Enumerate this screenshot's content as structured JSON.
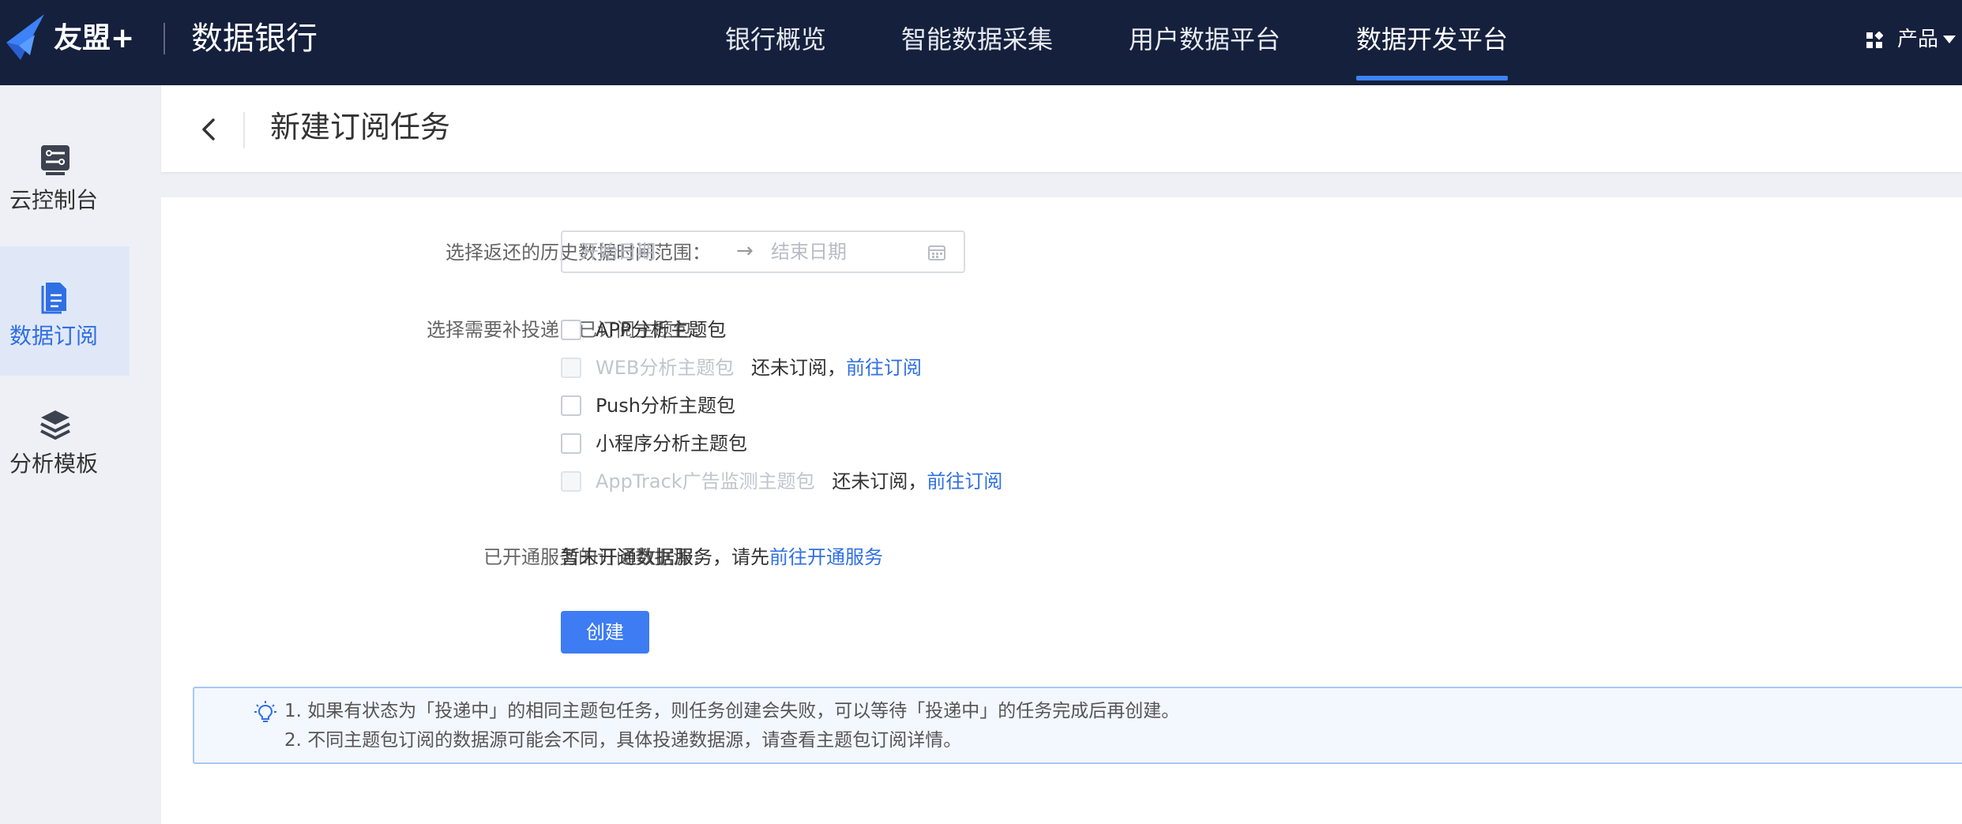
{
  "topbar": {
    "brand": "友盟+",
    "app_name": "数据银行",
    "nav": [
      {
        "label": "银行概览"
      },
      {
        "label": "智能数据采集"
      },
      {
        "label": "用户数据平台"
      },
      {
        "label": "数据开发平台",
        "active": true
      }
    ],
    "product_label": "产品"
  },
  "sidebar": {
    "items": [
      {
        "label": "云控制台",
        "icon": "server-icon"
      },
      {
        "label": "数据订阅",
        "icon": "document-icon",
        "active": true
      },
      {
        "label": "分析模板",
        "icon": "layers-icon"
      }
    ]
  },
  "header": {
    "title": "新建订阅任务"
  },
  "form": {
    "date_label": "选择返还的历史数据时间范围：",
    "date_start_placeholder": "开始日期",
    "date_arrow": "→",
    "date_end_placeholder": "结束日期",
    "package_label": "选择需要补投递的已订阅主题包：",
    "packages": [
      {
        "label": "APP分析主题包",
        "disabled": false
      },
      {
        "label": "WEB分析主题包",
        "disabled": true,
        "note": "还未订阅，",
        "link": "前往订阅"
      },
      {
        "label": "Push分析主题包",
        "disabled": false
      },
      {
        "label": "小程序分析主题包",
        "disabled": false
      },
      {
        "label": "AppTrack广告监测主题包",
        "disabled": true,
        "note": "还未订阅，",
        "link": "前往订阅"
      }
    ],
    "source_label": "已开通服务的订阅数据源：",
    "source_text": "暂未开通数据服务，请先",
    "source_link": "前往开通服务",
    "create_label": "创建"
  },
  "notice": {
    "line1": "1. 如果有状态为「投递中」的相同主题包任务，则任务创建会失败，可以等待「投递中」的任务完成后再创建。",
    "line2": "2. 不同主题包订阅的数据源可能会不同，具体投递数据源，请查看主题包订阅详情。"
  },
  "colors": {
    "topbar_bg": "#15203d",
    "accent": "#3d7cf3",
    "link": "#2f6fe4"
  }
}
